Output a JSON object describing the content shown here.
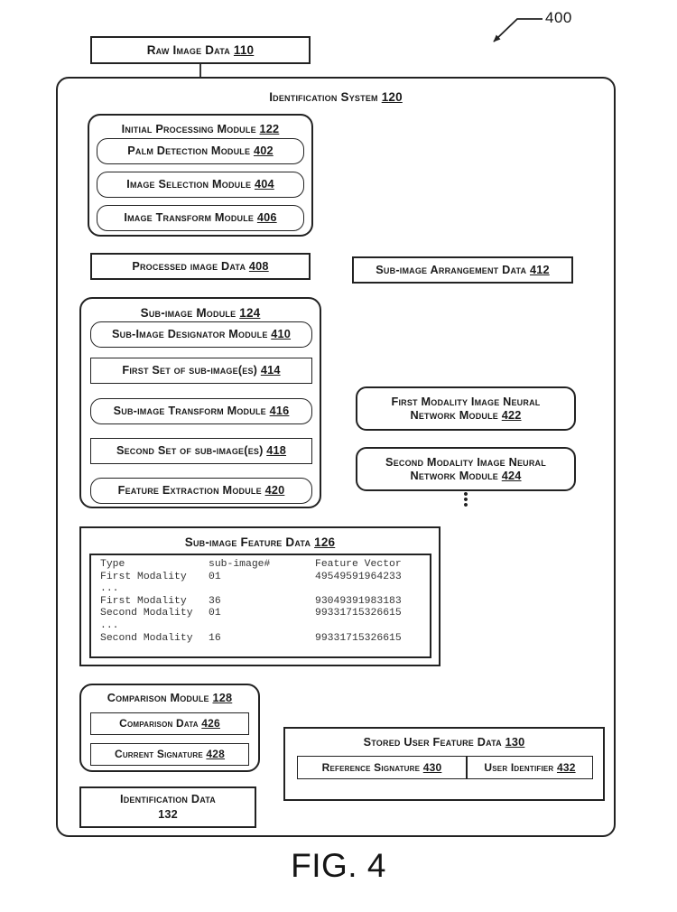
{
  "figure": {
    "caption": "FIG. 4",
    "reference_number": "400"
  },
  "nodes": {
    "raw_image_data": {
      "label": "Raw Image Data",
      "ref": "110"
    },
    "identification_system": {
      "label": "Identification System",
      "ref": "120"
    },
    "initial_processing_module": {
      "label": "Initial Processing Module",
      "ref": "122"
    },
    "palm_detection_module": {
      "label": "Palm Detection Module",
      "ref": "402"
    },
    "image_selection_module": {
      "label": "Image Selection Module",
      "ref": "404"
    },
    "image_transform_module": {
      "label": "Image Transform Module",
      "ref": "406"
    },
    "processed_image_data": {
      "label": "Processed image Data",
      "ref": "408"
    },
    "sub_image_arrangement_data": {
      "label": "Sub-image Arrangement Data",
      "ref": "412"
    },
    "sub_image_module": {
      "label": "Sub-image Module",
      "ref": "124"
    },
    "sub_image_designator_module": {
      "label": "Sub-Image Designator Module",
      "ref": "410"
    },
    "first_set_of_sub_images": {
      "label": "First Set of sub-image(es)",
      "ref": "414"
    },
    "sub_image_transform_module": {
      "label": "Sub-image Transform Module",
      "ref": "416"
    },
    "second_set_of_sub_images": {
      "label": "Second Set of sub-image(es)",
      "ref": "418"
    },
    "feature_extraction_module": {
      "label": "Feature Extraction Module",
      "ref": "420"
    },
    "first_modality_nn_module": {
      "label_line1": "First Modality Image Neural",
      "label_line2": "Network Module",
      "ref": "422"
    },
    "second_modality_nn_module": {
      "label_line1": "Second Modality Image Neural",
      "label_line2": "Network Module",
      "ref": "424"
    },
    "modality_more_indicator": {
      "glyph": "vertical-ellipsis"
    },
    "sub_image_feature_data": {
      "label": "Sub-image Feature Data",
      "ref": "126"
    },
    "comparison_module": {
      "label": "Comparison Module",
      "ref": "128"
    },
    "comparison_data": {
      "label": "Comparison Data",
      "ref": "426"
    },
    "current_signature": {
      "label": "Current Signature",
      "ref": "428"
    },
    "identification_data": {
      "label": "Identification Data",
      "ref": "132"
    },
    "stored_user_feature_data": {
      "label": "Stored User Feature Data",
      "ref": "130"
    },
    "reference_signature": {
      "label": "Reference Signature",
      "ref": "430"
    },
    "user_identifier": {
      "label": "User Identifier",
      "ref": "432"
    }
  },
  "feature_data_table": {
    "headers": [
      "Type",
      "sub-image#",
      "Feature Vector"
    ],
    "rows": [
      [
        "First Modality",
        "01",
        "49549591964233"
      ],
      [
        "...",
        "",
        ""
      ],
      [
        "First Modality",
        "36",
        "93049391983183"
      ],
      [
        "Second Modality",
        "01",
        "99331715326615"
      ],
      [
        "...",
        "",
        ""
      ],
      [
        "Second Modality",
        "16",
        "99331715326615"
      ]
    ]
  },
  "colors": {
    "line": "#222222",
    "background": "#ffffff",
    "text": "#1a1a1a",
    "mono_text": "#333333"
  }
}
